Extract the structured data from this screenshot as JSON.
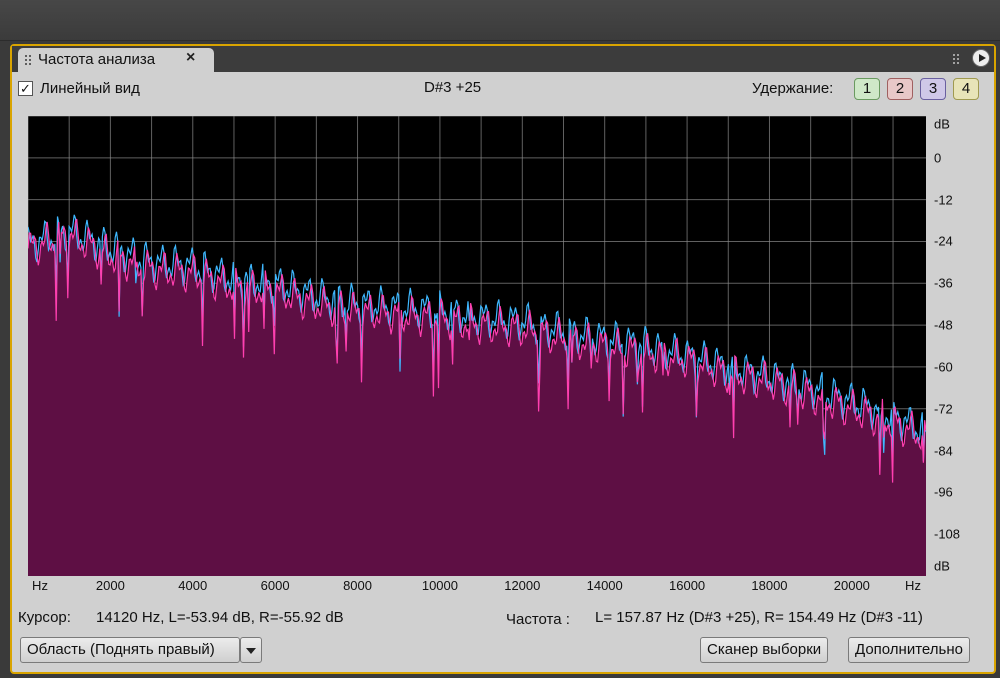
{
  "panel": {
    "tab_title": "Частота  анализа",
    "close_glyph": "×"
  },
  "toolbar": {
    "linear_view_checked": true,
    "check_glyph": "✓",
    "linear_view_label": "Линейный вид",
    "note_readout": "D#3 +25",
    "hold_label": "Удержание:",
    "hold_buttons": [
      {
        "label": "1",
        "color": "#cfe8c8",
        "border": "#6a9a60"
      },
      {
        "label": "2",
        "color": "#e8c8c8",
        "border": "#a06060"
      },
      {
        "label": "3",
        "color": "#cfc8e8",
        "border": "#6a60a0"
      },
      {
        "label": "4",
        "color": "#e8e4b8",
        "border": "#a09a50"
      }
    ]
  },
  "status": {
    "cursor_label": "Курсор:",
    "cursor_value": "14120 Hz, L=-53.94 dB, R=-55.92 dB",
    "freq_label": "Частота :",
    "freq_value": "L= 157.87 Hz (D#3 +25), R= 154.49 Hz (D#3 -11)"
  },
  "buttons": {
    "region": "Область (Поднять правый)",
    "scanner": "Сканер выборки",
    "more": "Дополнительно"
  },
  "colors": {
    "fill": "#5e0f44",
    "left_channel": "#ff3fb0",
    "right_channel": "#3fb8ff",
    "grid": "#8a8a8a",
    "accent_border": "#d9a400"
  },
  "chart_data": {
    "type": "area",
    "xlabel": "Hz",
    "ylabel": "dB",
    "xlim": [
      0,
      21800
    ],
    "ylim": [
      -120,
      12
    ],
    "x_ticks": [
      "Hz",
      "2000",
      "4000",
      "6000",
      "8000",
      "10000",
      "12000",
      "14000",
      "16000",
      "18000",
      "20000",
      "Hz"
    ],
    "y_ticks": [
      "dB",
      "0",
      "-12",
      "-24",
      "-36",
      "-48",
      "-60",
      "-72",
      "-84",
      "-96",
      "-108",
      "dB"
    ],
    "grid": true,
    "series": [
      {
        "name": "L",
        "color": "#ff3fb0",
        "x": [
          0,
          1000,
          2000,
          3000,
          4000,
          5000,
          6000,
          7000,
          8000,
          9000,
          10000,
          11000,
          12000,
          13000,
          14000,
          15000,
          16000,
          17000,
          18000,
          19000,
          20000,
          21000,
          21800
        ],
        "values": [
          -26,
          -22,
          -28,
          -32,
          -33,
          -37,
          -38,
          -42,
          -44,
          -45,
          -46,
          -48,
          -49,
          -52,
          -54,
          -56,
          -58,
          -62,
          -64,
          -68,
          -72,
          -76,
          -80
        ]
      },
      {
        "name": "R",
        "color": "#3fb8ff",
        "x": [
          0,
          1000,
          2000,
          3000,
          4000,
          5000,
          6000,
          7000,
          8000,
          9000,
          10000,
          11000,
          12000,
          13000,
          14000,
          15000,
          16000,
          17000,
          18000,
          19000,
          20000,
          21000,
          21800
        ],
        "values": [
          -25,
          -21,
          -26,
          -30,
          -31,
          -35,
          -36,
          -40,
          -42,
          -43,
          -44,
          -46,
          -47,
          -50,
          -52,
          -54,
          -57,
          -60,
          -63,
          -66,
          -70,
          -74,
          -79
        ]
      }
    ]
  }
}
